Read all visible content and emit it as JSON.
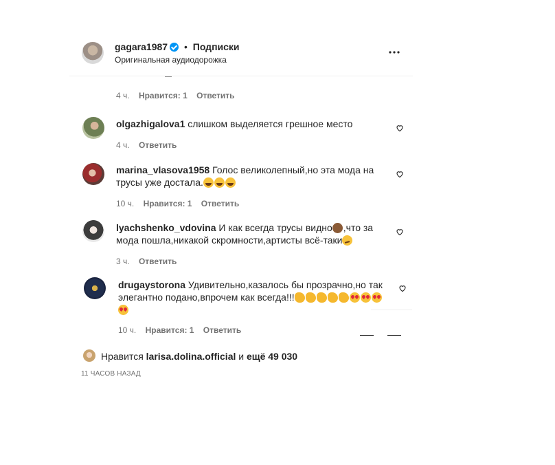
{
  "header": {
    "username": "gagara1987",
    "dot": "•",
    "follow_label": "Подписки",
    "subtitle": "Оригинальная аудиодорожка",
    "more_icon": "more-horizontal-icon"
  },
  "partial_top": {
    "time": "4 ч.",
    "likes": "Нравится: 1",
    "reply": "Ответить"
  },
  "comments": [
    {
      "username": "olgazhigalova1",
      "text": "слишком выделяется грешное место",
      "time": "4 ч.",
      "reply": "Ответить"
    },
    {
      "username": "marina_vlasova1958",
      "text": "Голос великолепный,но эта мода на трусы уже достала.",
      "time": "10 ч.",
      "likes": "Нравится: 1",
      "reply": "Ответить"
    },
    {
      "username": "lyachshenko_vdovina",
      "text_a": "И как всегда трусы видно",
      "text_b": ",что за мода пошла,никакой скромности,артисты всё-таки",
      "time": "3 ч.",
      "reply": "Ответить"
    },
    {
      "username": "drugaystorona",
      "text": "Удивительно,казалось бы прозрачно,но так элегантно подано,впрочем как всегда!!!",
      "time": "10 ч.",
      "likes": "Нравится: 1",
      "reply": "Ответить"
    }
  ],
  "likes_row": {
    "prefix": "Нравится",
    "user": "larisa.dolina.official",
    "and": "и",
    "rest": "ещё 49 030"
  },
  "timestamp": "11 ЧАСОВ НАЗАД",
  "colors": {
    "text": "#262626",
    "muted": "#737373",
    "verified": "#0095f6",
    "divider": "#efefef"
  }
}
